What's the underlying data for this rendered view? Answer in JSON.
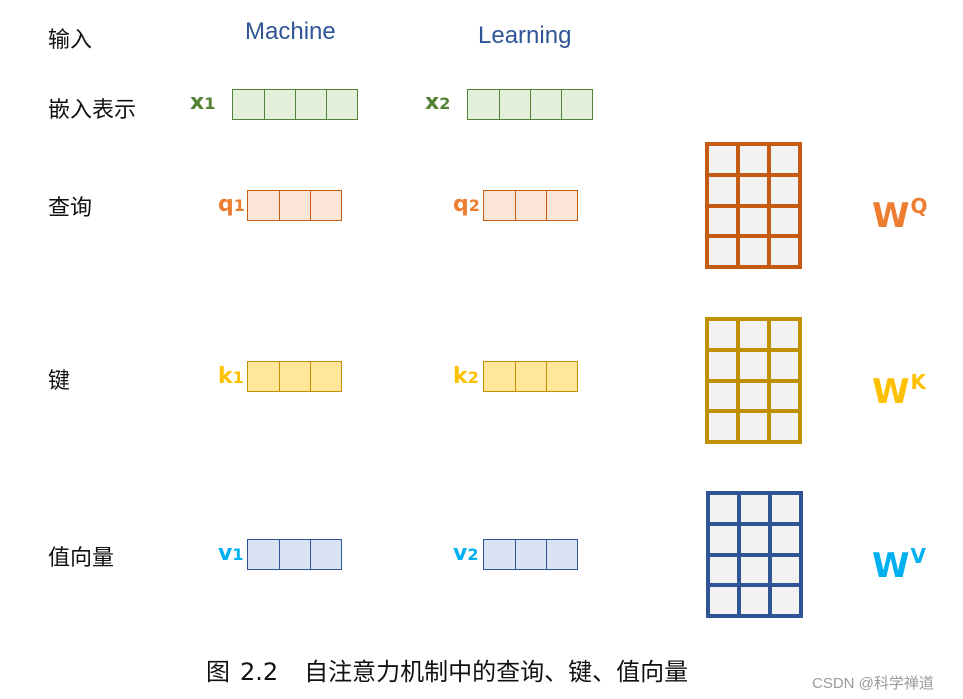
{
  "row_labels": {
    "input": "输入",
    "embedding": "嵌入表示",
    "query": "查询",
    "key": "键",
    "value": "值向量"
  },
  "words": [
    "Machine",
    "Learning"
  ],
  "vectors": {
    "embedding": {
      "color": "#548235",
      "fill": "#E2EFDA",
      "border": "#548235",
      "cells": 4,
      "items": [
        {
          "main": "x",
          "sub": "1"
        },
        {
          "main": "x",
          "sub": "2"
        }
      ]
    },
    "query": {
      "color": "#ED7D31",
      "fill": "#FBE5D6",
      "border": "#C55A11",
      "cells": 3,
      "items": [
        {
          "main": "q",
          "sub": "1"
        },
        {
          "main": "q",
          "sub": "2"
        }
      ]
    },
    "key": {
      "color": "#FFC000",
      "fill": "#FFE699",
      "border": "#BF9000",
      "cells": 3,
      "items": [
        {
          "main": "k",
          "sub": "1"
        },
        {
          "main": "k",
          "sub": "2"
        }
      ]
    },
    "value": {
      "color": "#00B0F0",
      "fill": "#DAE3F3",
      "border": "#2F5597",
      "cells": 3,
      "items": [
        {
          "main": "v",
          "sub": "1"
        },
        {
          "main": "v",
          "sub": "2"
        }
      ]
    }
  },
  "matrices": [
    {
      "id": "q",
      "rows": 4,
      "cols": 3,
      "border": "#C55A11",
      "label": "W",
      "superscript": "Q",
      "label_color": "#ED7D31"
    },
    {
      "id": "k",
      "rows": 4,
      "cols": 3,
      "border": "#BF9000",
      "label": "W",
      "superscript": "K",
      "label_color": "#FFC000"
    },
    {
      "id": "v",
      "rows": 4,
      "cols": 3,
      "border": "#2F5597",
      "label": "W",
      "superscript": "V",
      "label_color": "#00B0F0"
    }
  ],
  "caption": {
    "prefix": "图",
    "number": "2.2",
    "text": "自注意力机制中的查询、键、值向量"
  },
  "watermark": "CSDN @科学禅道"
}
